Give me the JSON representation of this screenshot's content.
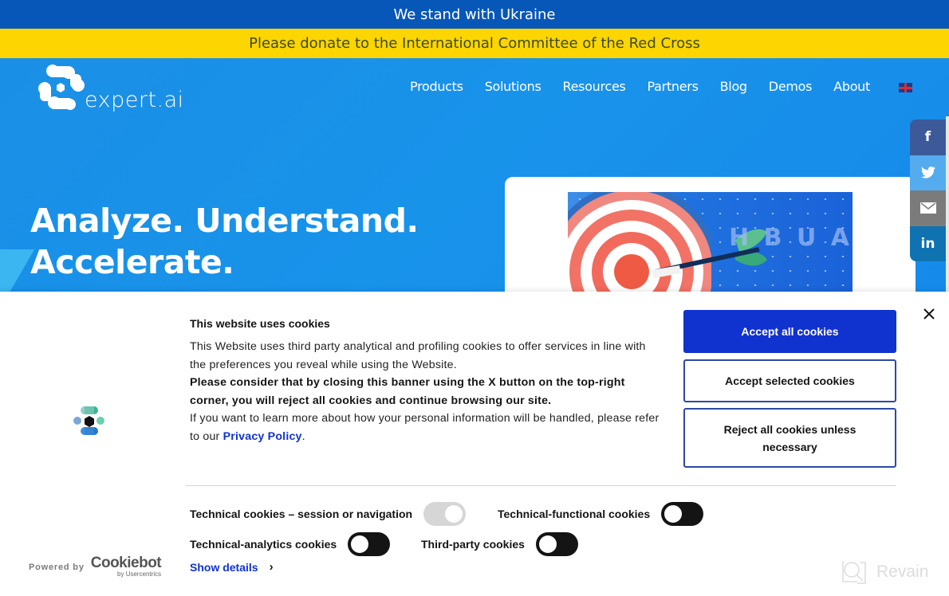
{
  "banners": {
    "ukraine": "We stand with Ukraine",
    "donate": "Please donate to the International Committee of the Red Cross"
  },
  "header": {
    "logo_text": "expert.ai",
    "nav": [
      "Products",
      "Solutions",
      "Resources",
      "Partners",
      "Blog",
      "Demos",
      "About"
    ],
    "language_flag": "uk-flag-icon"
  },
  "hero": {
    "headline_line1": "Analyze. Understand.",
    "headline_line2": "Accelerate.",
    "card_image_letters": "H B U A"
  },
  "share": {
    "facebook": "f",
    "twitter": "twitter-icon",
    "email": "email-icon",
    "linkedin": "in"
  },
  "cookie_banner": {
    "title": "This website uses cookies",
    "text1": "This Website uses third party analytical and profiling cookies to offer services in line with the preferences you reveal while using the Website.",
    "text_bold": "Please consider that by closing this banner using the X button on the top-right corner, you will reject all cookies and continue browsing our site.",
    "text2": "If you want to learn more about how your personal information will be handled, please refer to our ",
    "privacy_link": "Privacy Policy",
    "text2_end": ".",
    "buttons": {
      "accept_all": "Accept all cookies",
      "accept_selected": "Accept selected cookies",
      "reject": "Reject all cookies unless necessary"
    },
    "toggles": [
      {
        "label": "Technical cookies – session or navigation",
        "state": "on",
        "disabled": true
      },
      {
        "label": "Technical-functional cookies",
        "state": "off",
        "disabled": false
      },
      {
        "label": "Technical-analytics cookies",
        "state": "off",
        "disabled": false
      },
      {
        "label": "Third-party cookies",
        "state": "off",
        "disabled": false
      }
    ],
    "show_details": "Show details",
    "powered_by": "Powered by",
    "cookiebot_name": "Cookiebot",
    "cookiebot_sub": "by Usercentrics"
  },
  "watermark": "Revain",
  "colors": {
    "ukraine_blue": "#0757b8",
    "ukraine_yellow": "#fdd500",
    "hero_blue": "#1893ea",
    "cookie_primary": "#1032cf"
  }
}
